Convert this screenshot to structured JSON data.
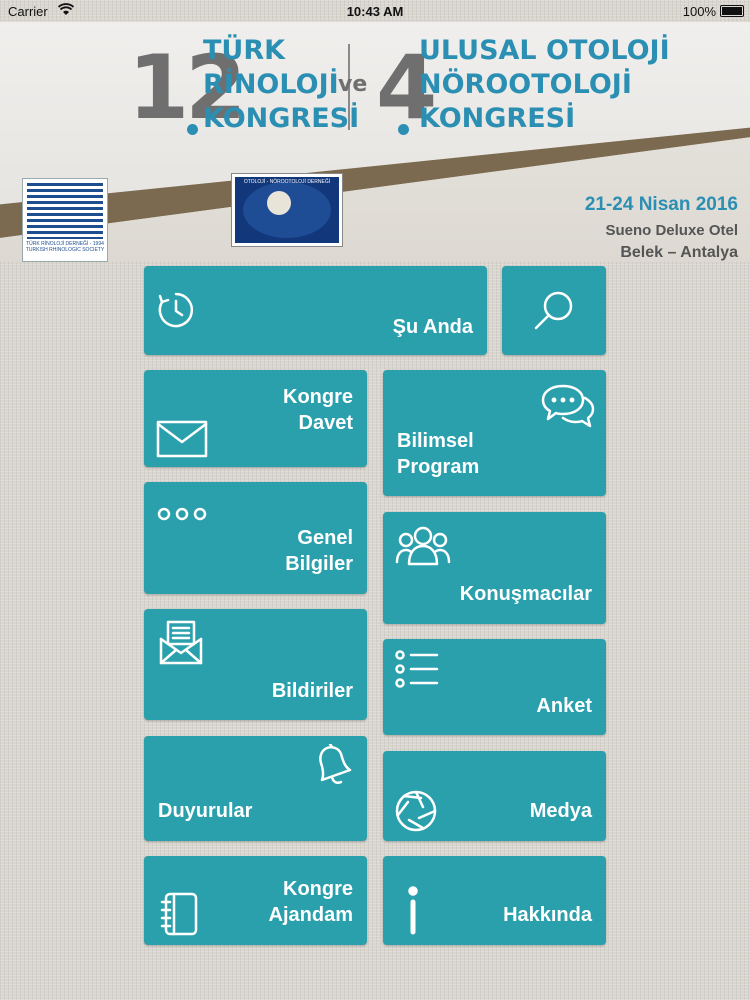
{
  "status_bar": {
    "carrier": "Carrier",
    "time": "10:43 AM",
    "battery": "100%"
  },
  "header": {
    "left_number": "12",
    "left_lines": [
      "TÜRK",
      "RİNOLOJİ",
      "KONGRESİ"
    ],
    "connector": "ve",
    "right_number": "4",
    "right_lines": [
      "ULUSAL OTOLOJİ",
      "NÖROOTOLOJİ",
      "KONGRESİ"
    ],
    "date": "21-24 Nisan 2016",
    "venue": "Sueno Deluxe Otel",
    "location": "Belek – Antalya",
    "logo_left_caption": "TÜRK RİNOLOJİ DERNEĞİ - 1994 TURKISH RHINOLOGIC SOCIETY",
    "logo_right_caption": "OTOLOJİ - NÖROOTOLOJİ DERNEĞİ"
  },
  "tiles": {
    "su_anda": "Şu Anda",
    "kongre_davet": [
      "Kongre",
      "Davet"
    ],
    "bilimsel_program": [
      "Bilimsel",
      "Program"
    ],
    "genel_bilgiler": [
      "Genel",
      "Bilgiler"
    ],
    "konusmacilar": "Konuşmacılar",
    "bildiriler": "Bildiriler",
    "anket": "Anket",
    "duyurular": "Duyurular",
    "medya": "Medya",
    "kongre_ajandam": [
      "Kongre",
      "Ajandam"
    ],
    "hakkinda": "Hakkında"
  },
  "colors": {
    "tile": "#2aa0ad",
    "accent": "#2b8fb3",
    "brown_band": "#7b6a4f"
  }
}
